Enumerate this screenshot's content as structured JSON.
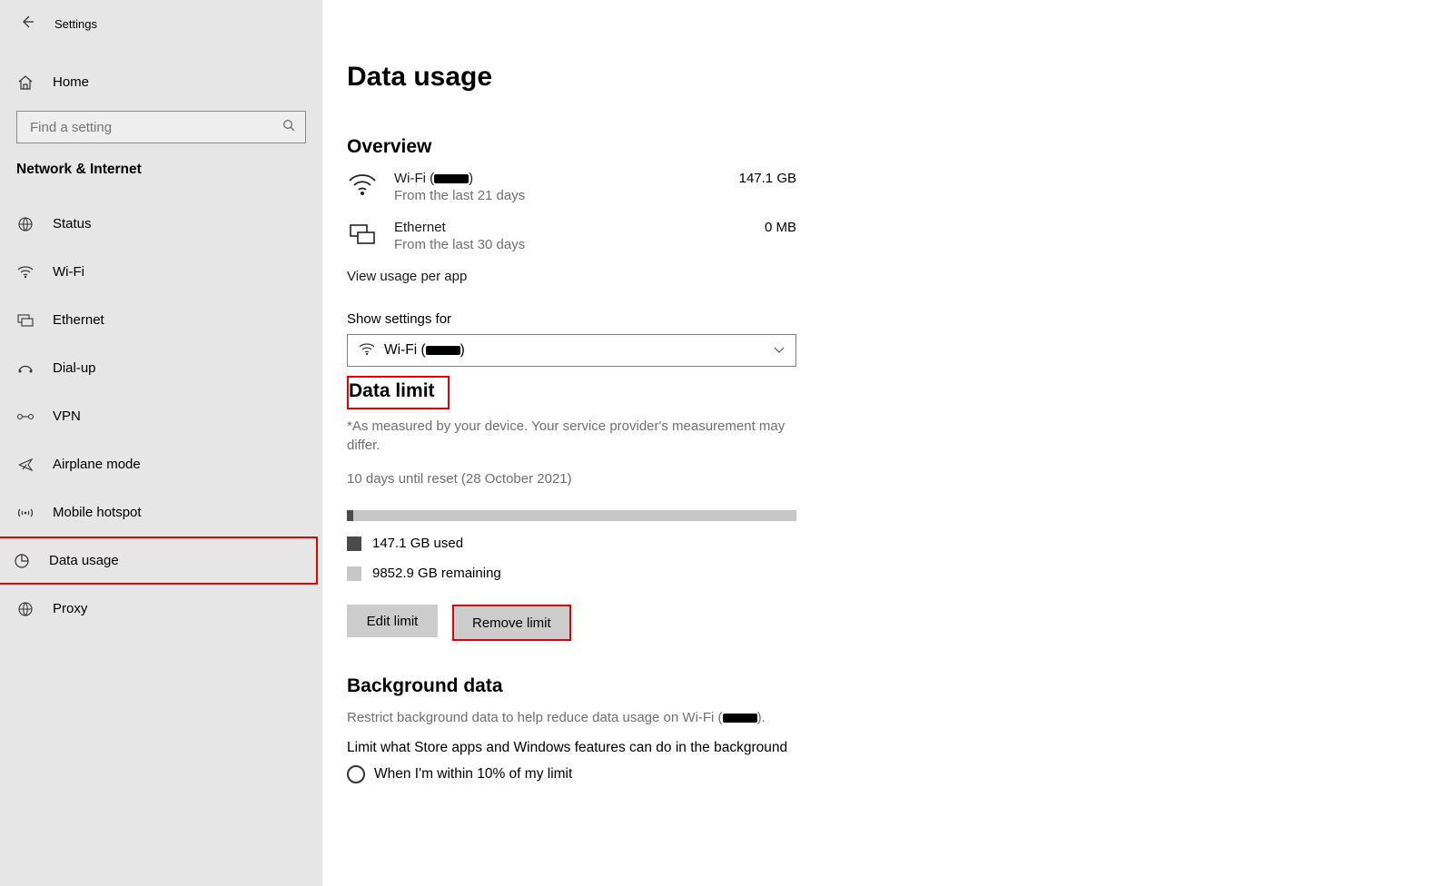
{
  "titlebar": {
    "title": "Settings"
  },
  "sidebar": {
    "home_label": "Home",
    "search_placeholder": "Find a setting",
    "section_title": "Network & Internet",
    "items": [
      {
        "label": "Status"
      },
      {
        "label": "Wi-Fi"
      },
      {
        "label": "Ethernet"
      },
      {
        "label": "Dial-up"
      },
      {
        "label": "VPN"
      },
      {
        "label": "Airplane mode"
      },
      {
        "label": "Mobile hotspot"
      },
      {
        "label": "Data usage"
      },
      {
        "label": "Proxy"
      }
    ]
  },
  "main": {
    "page_title": "Data usage",
    "overview_heading": "Overview",
    "wifi": {
      "name_prefix": "Wi-Fi (",
      "name_suffix": ")",
      "subtitle": "From the last 21 days",
      "amount": "147.1 GB"
    },
    "ethernet": {
      "name": "Ethernet",
      "subtitle": "From the last 30 days",
      "amount": "0 MB"
    },
    "view_usage_link": "View usage per app",
    "show_settings_label": "Show settings for",
    "dropdown_prefix": "Wi-Fi (",
    "dropdown_suffix": ")",
    "data_limit_heading": "Data limit",
    "data_limit_note": "*As measured by your device. Your service provider's measurement may differ.",
    "reset_note": "10 days until reset (28 October 2021)",
    "used_label": "147.1 GB used",
    "remaining_label": "9852.9 GB remaining",
    "edit_btn": "Edit limit",
    "remove_btn": "Remove limit",
    "background_heading": "Background data",
    "background_note_prefix": "Restrict background data to help reduce data usage on Wi-Fi (",
    "background_note_suffix": ").",
    "limit_desc": "Limit what Store apps and Windows features can do in the background",
    "radio_label": "When I'm within 10% of my limit"
  }
}
